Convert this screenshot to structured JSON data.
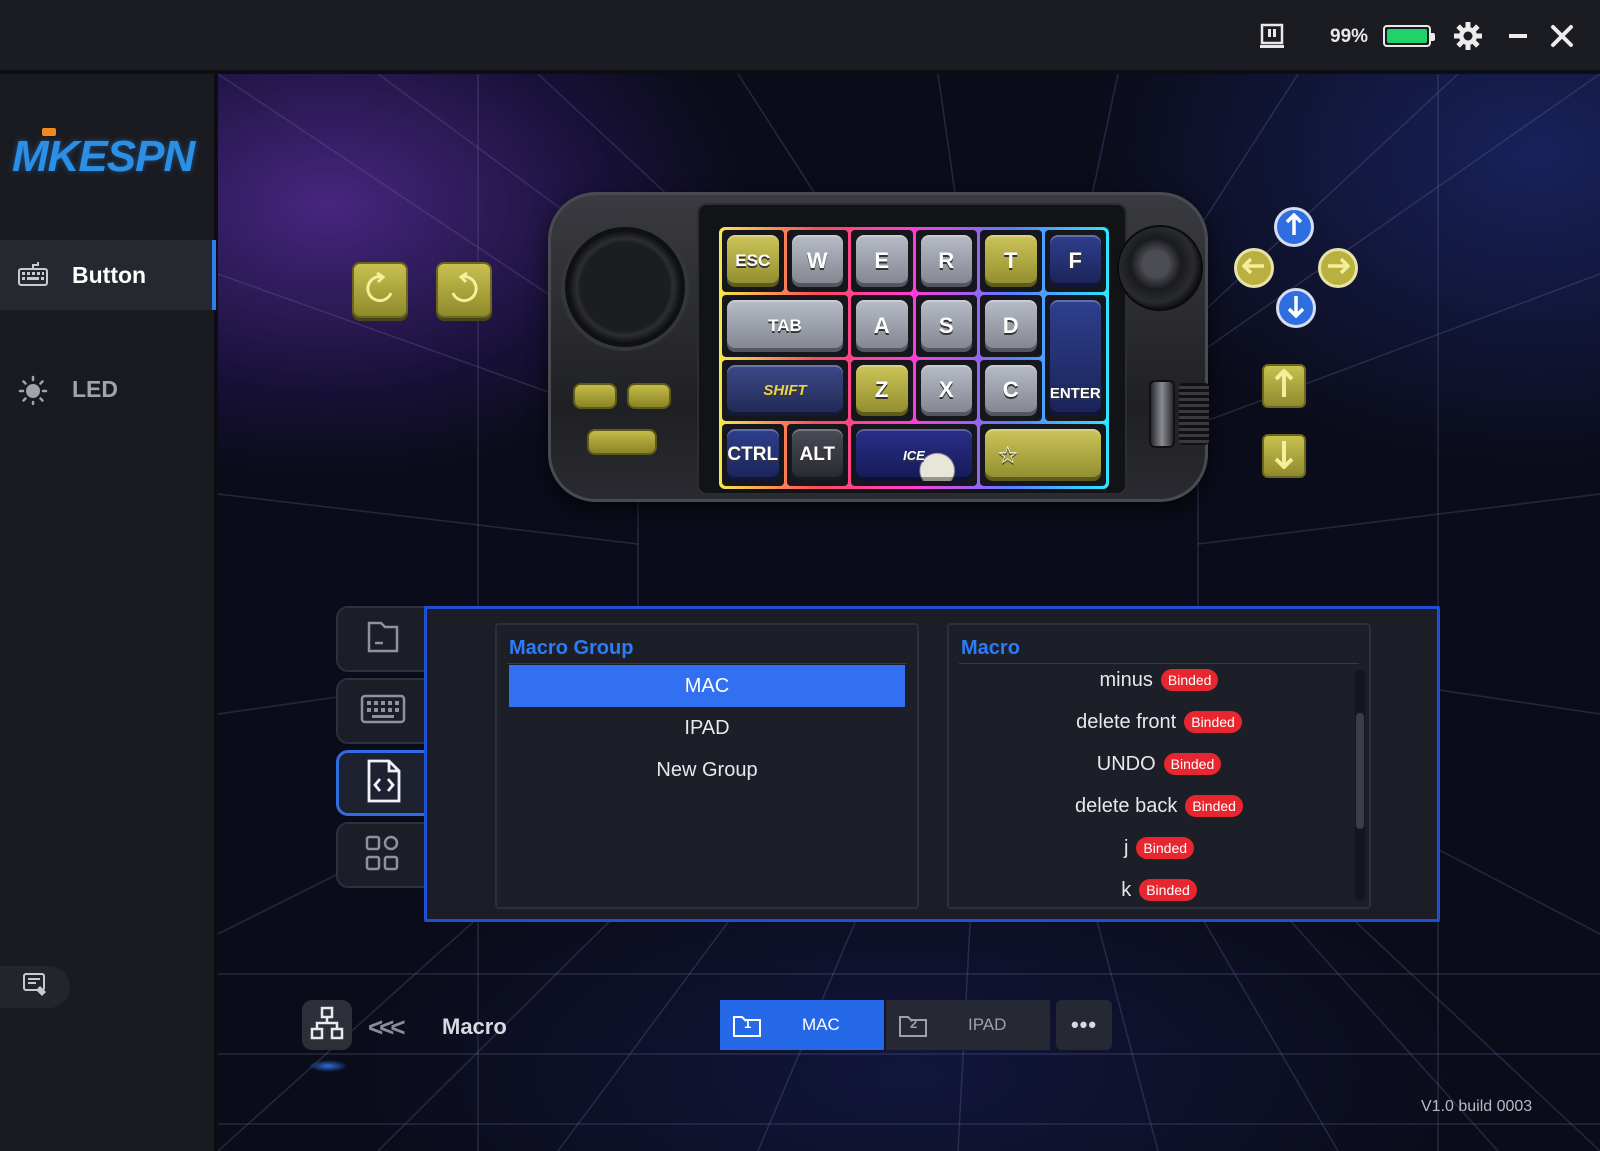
{
  "titlebar": {
    "battery_text": "99%",
    "battery_level": 0.99,
    "icons": [
      "device-icon",
      "battery-icon",
      "gear-icon",
      "minimize-icon",
      "close-icon"
    ]
  },
  "sidebar": {
    "logo": "MKESPN",
    "items": [
      {
        "label": "Button",
        "icon": "keyboard-icon",
        "active": true
      },
      {
        "label": "LED",
        "icon": "sun-icon",
        "active": false
      }
    ],
    "feedback_icon": "feedback-icon"
  },
  "device": {
    "keys": [
      "ESC",
      "W",
      "E",
      "R",
      "T",
      "F",
      "TAB",
      "A",
      "S",
      "D",
      "ENTER",
      "SHIFT",
      "Z",
      "X",
      "C",
      "CTRL",
      "ALT",
      "ICE",
      "☆"
    ]
  },
  "side_tabs": [
    "folder-icon",
    "keyboard-icon",
    "code-file-icon",
    "grid-icon"
  ],
  "macro_group": {
    "title": "Macro Group",
    "items": [
      "MAC",
      "IPAD",
      "New Group"
    ],
    "selected": "MAC"
  },
  "macro": {
    "title": "Macro",
    "badge": "Binded",
    "items": [
      "minus",
      "delete front",
      "UNDO",
      "delete back",
      "j",
      "k"
    ]
  },
  "bottom": {
    "mode_label": "Macro",
    "chevrons": "<<<",
    "groups": [
      {
        "num": "1",
        "label": "MAC",
        "active": true
      },
      {
        "num": "2",
        "label": "IPAD",
        "active": false
      }
    ],
    "more": "•••"
  },
  "version": "V1.0 build 0003",
  "colors": {
    "accent": "#2f6ee0",
    "badge": "#e8262f",
    "battery": "#21d16a",
    "macro_title": "#2c7cf7"
  }
}
